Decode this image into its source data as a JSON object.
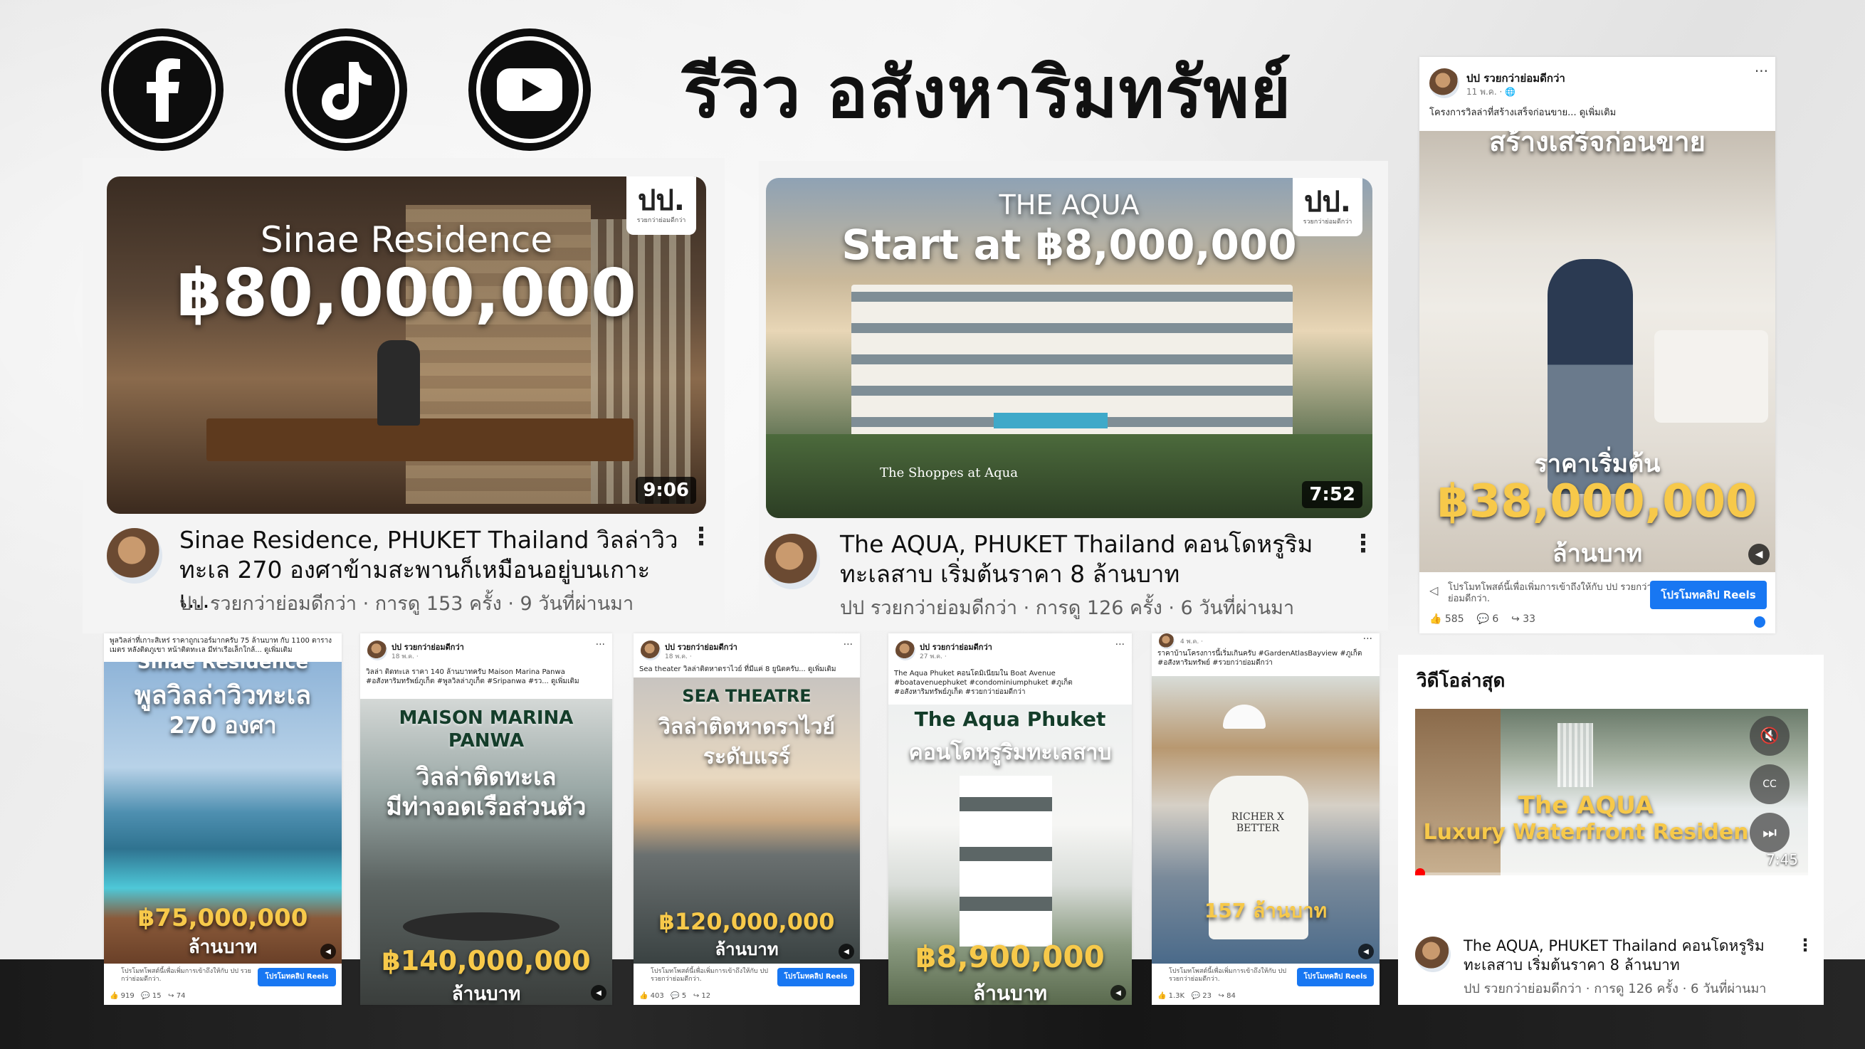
{
  "header": {
    "title": "รีวิว อสังหาริมทรัพย์",
    "social": [
      "facebook-icon",
      "tiktok-icon",
      "youtube-icon"
    ]
  },
  "youtube_cards": [
    {
      "overlay_title": "Sinae Residence",
      "overlay_price": "฿80,000,000",
      "duration": "9:06",
      "title": "Sinae Residence, PHUKET Thailand วิลล่าวิว ทะเล 270 องศาข้ามสะพานก็เหมือนอยู่บนเกาะ เ...",
      "meta": "ปป รวยกว่าย่อมดีกว่า · การดู 153 ครั้ง · 9 วันที่ผ่านมา"
    },
    {
      "overlay_title": "THE AQUA",
      "overlay_price": "Start at ฿8,000,000",
      "overlay_caption": "The Shoppes at Aqua",
      "duration": "7:52",
      "title": "The AQUA, PHUKET Thailand คอนโดหรูริม ทะเลสาบ เริ่มต้นราคา 8 ล้านบาท",
      "meta": "ปป รวยกว่าย่อมดีกว่า · การดู 126 ครั้ง · 6 วันที่ผ่านมา"
    }
  ],
  "logo": {
    "mark": "ปป.",
    "sub": "รวยกว่าย่อมดีกว่า"
  },
  "fb_big": {
    "name": "ปป รวยกว่าย่อมดีกว่า",
    "date": "11 พ.ค. · 🌐",
    "caption": "โครงการวิลล่าที่สร้างเสร็จก่อนขาย... ดูเพิ่มเติม",
    "overlay_top": "สร้างเสร็จก่อนขาย",
    "overlay_label": "ราคาเริ่มต้น",
    "overlay_price": "฿38,000,000",
    "overlay_unit": "ล้านบาท",
    "promo_text": "โปรโมทโพสต์นี้เพื่อเพิ่มการเข้าถึงให้กับ ปป รวยกว่าย่อมดีกว่า.",
    "promo_button": "โปรโมทคลิป Reels",
    "likes": "585",
    "comments": "6",
    "shares": "33"
  },
  "fb_small": [
    {
      "caption": "พูลวิลล่าที่เกาะสิเหร่ ราคาถูกเวอร์มากครับ 75 ล้านบาท กับ 1100 ตารางเมตร หลังติดภูเขา หน้าติดทะเล มีท่าเรือเล็กใกล้... ดูเพิ่มเติม",
      "lines": [
        "Sinae Residence",
        "พูลวิลล่าวิวทะเล",
        "270 องศา"
      ],
      "price": "฿75,000,000",
      "unit": "ล้านบาท",
      "promo_text": "โปรโมทโพสต์นี้เพื่อเพิ่มการเข้าถึงให้กับ ปป รวยกว่าย่อมดีกว่า.",
      "promo_button": "โปรโมทคลิป Reels",
      "likes": "919",
      "comments": "15",
      "shares": "74"
    },
    {
      "name": "ปป รวยกว่าย่อมดีกว่า",
      "date": "18 พ.ค. ·",
      "caption": "วิลล่า ติดทะเล ราคา 140 ล้านบาทครับ Maison Marina Panwa #อสังหาริมทรัพย์ภูเก็ต #พูลวิลล่าภูเก็ต #Sripanwa #รว... ดูเพิ่มเติม",
      "lines": [
        "MAISON MARINA",
        "PANWA",
        "วิลล่าติดทะเล",
        "มีท่าจอดเรือส่วนตัว"
      ],
      "price": "฿140,000,000",
      "unit": "ล้านบาท"
    },
    {
      "name": "ปป รวยกว่าย่อมดีกว่า",
      "date": "18 พ.ค. ·",
      "caption": "Sea theater วิลล่าติดหาดราไวย์ ที่มีแค่ 8 ยูนิตครับ... ดูเพิ่มเติม",
      "lines": [
        "SEA THEATRE",
        "วิลล่าติดหาดราไวย์",
        "ระดับแรร์"
      ],
      "price": "฿120,000,000",
      "unit": "ล้านบาท",
      "promo_text": "โปรโมทโพสต์นี้เพื่อเพิ่มการเข้าถึงให้กับ ปป รวยกว่าย่อมดีกว่า.",
      "promo_button": "โปรโมทคลิป Reels",
      "likes": "403",
      "comments": "5",
      "shares": "12"
    },
    {
      "name": "ปป รวยกว่าย่อมดีกว่า",
      "date": "27 พ.ค. ·",
      "caption": "The Aqua Phuket คอนโดมิเนียมใน Boat Avenue #boatavenuephuket #condominiumphuket #ภูเก็ต #อสังหาริมทรัพย์ภูเก็ต #รวยกว่าย่อมดีกว่า",
      "lines": [
        "The Aqua Phuket",
        "คอนโดหรูริมทะเลสาบ"
      ],
      "price": "฿8,900,000",
      "unit": "ล้านบาท"
    },
    {
      "name": "",
      "date": "4 พ.ค. ·",
      "caption": "ราคาบ้านโครงการนี้เริ่มเกินครับ #GardenAtlasBayview #ภูเก็ต #อสังหาริมทรัพย์ #รวยกว่าย่อมดีกว่า",
      "lines": [],
      "shirt": "RICHER X BETTER",
      "price": "157 ล้านบาท",
      "promo_text": "โปรโมทโพสต์นี้เพื่อเพิ่มการเข้าถึงให้กับ ปป รวยกว่าย่อมดีกว่า.",
      "promo_button": "โปรโมทคลิป Reels",
      "likes": "1.3K",
      "comments": "23",
      "shares": "84"
    }
  ],
  "latest": {
    "heading": "วิดีโอล่าสุด",
    "overlay_title": "The AQUA",
    "overlay_sub": "Luxury Waterfront Residen",
    "duration": "7:45",
    "title": "The AQUA, PHUKET Thailand คอนโดหรูริม ทะเลสาบ เริ่มต้นราคา 8 ล้านบาท",
    "meta": "ปป รวยกว่าย่อมดีกว่า · การดู 126 ครั้ง · 6 วันที่ผ่านมา"
  }
}
